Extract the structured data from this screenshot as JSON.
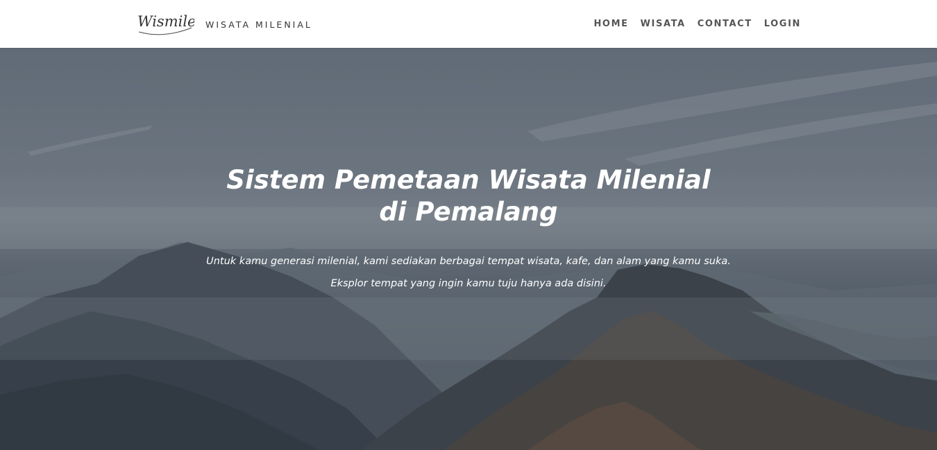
{
  "brand": {
    "logo_text": "Wismile",
    "name": "WISATA MILENIAL"
  },
  "nav": {
    "items": [
      {
        "label": "HOME"
      },
      {
        "label": "WISATA"
      },
      {
        "label": "CONTACT"
      },
      {
        "label": "LOGIN"
      }
    ]
  },
  "hero": {
    "title_line1": "Sistem Pemetaan Wisata Milenial",
    "title_line2": "di Pemalang",
    "subtitle_line1": "Untuk kamu generasi milenial, kami sediakan berbagai tempat wisata, kafe, dan alam yang kamu suka.",
    "subtitle_line2": "Eksplor tempat yang ingin kamu tuju hanya ada disini."
  },
  "colors": {
    "navbar_bg": "#ffffff",
    "nav_text": "#555555",
    "hero_text": "#ffffff"
  }
}
